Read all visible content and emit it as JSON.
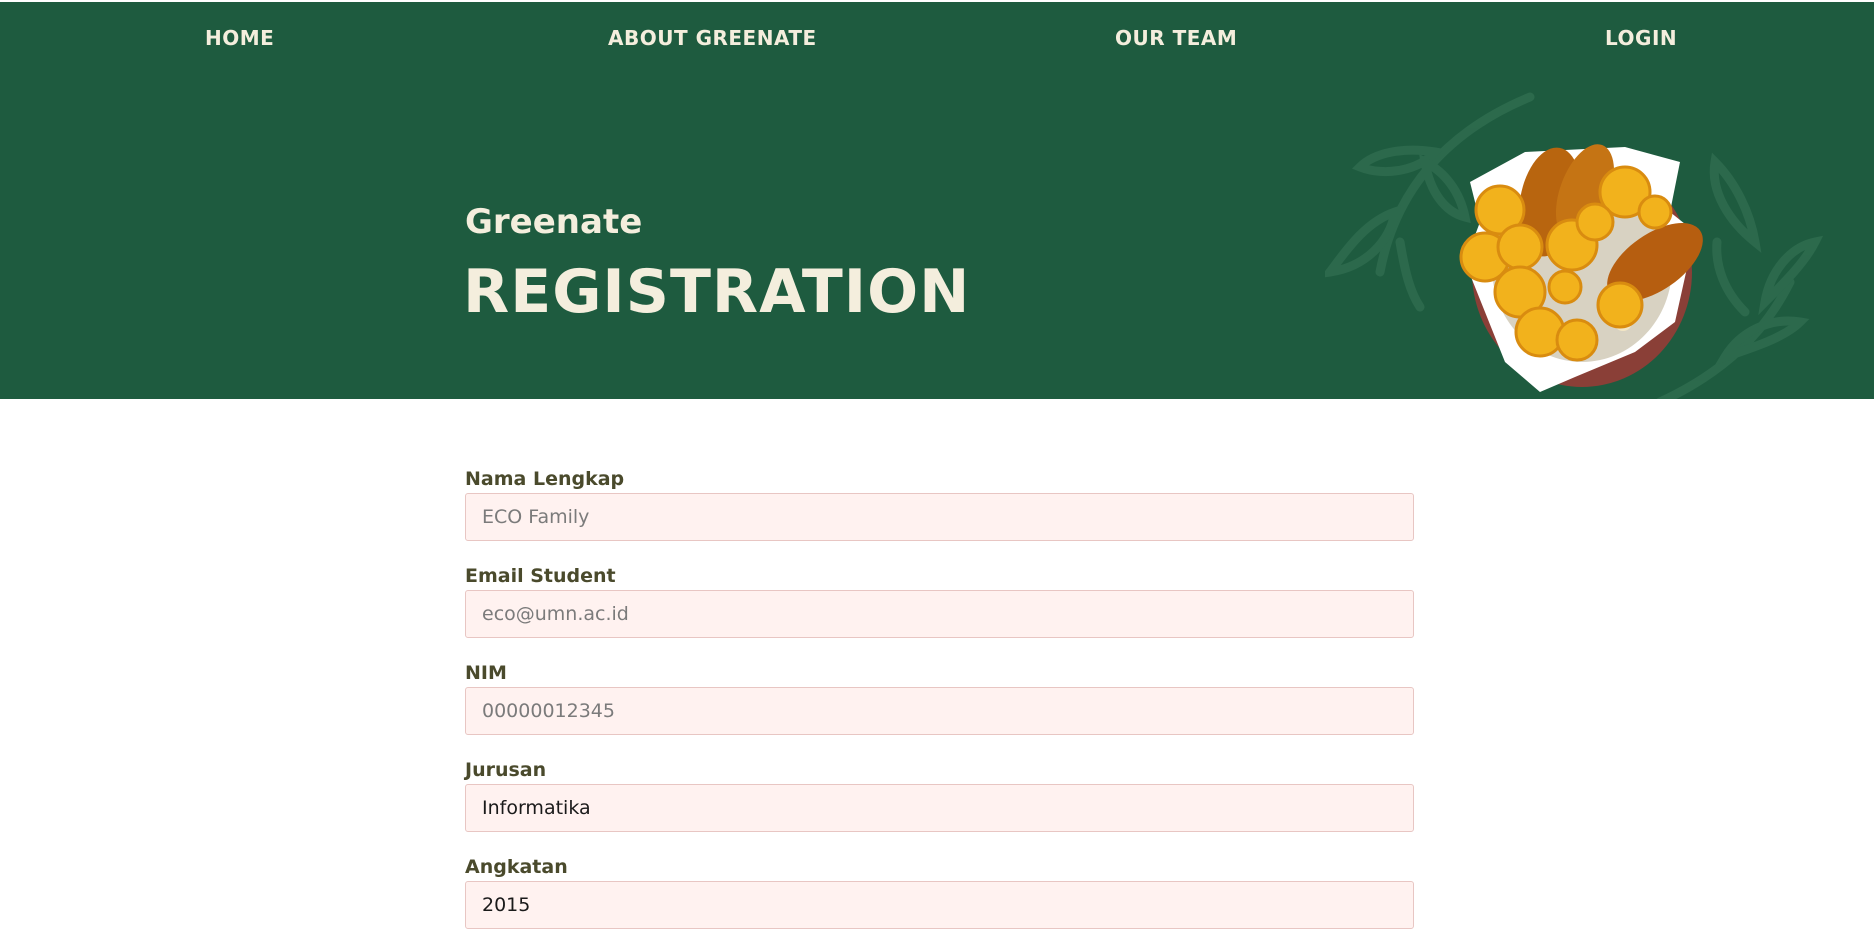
{
  "nav": {
    "home": "HOME",
    "about": "ABOUT GREENATE",
    "team": "OUR TEAM",
    "login": "LOGIN"
  },
  "hero": {
    "subtitle": "Greenate",
    "title": "REGISTRATION",
    "image_icon": "fried-chicken-plate-icon"
  },
  "form": {
    "fields": [
      {
        "label": "Nama Lengkap",
        "placeholder": "ECO Family",
        "value": ""
      },
      {
        "label": "Email Student",
        "placeholder": "eco@umn.ac.id",
        "value": ""
      },
      {
        "label": "NIM",
        "placeholder": "00000012345",
        "value": ""
      },
      {
        "label": "Jurusan",
        "placeholder": "",
        "value": "Informatika"
      },
      {
        "label": "Angkatan",
        "placeholder": "",
        "value": "2015"
      }
    ]
  },
  "colors": {
    "hero_bg": "#1e5b3f",
    "hero_text": "#f4eedd",
    "input_bg": "#fff2f0",
    "input_border": "#e8c6c3",
    "label_text": "#4a4a2c"
  }
}
